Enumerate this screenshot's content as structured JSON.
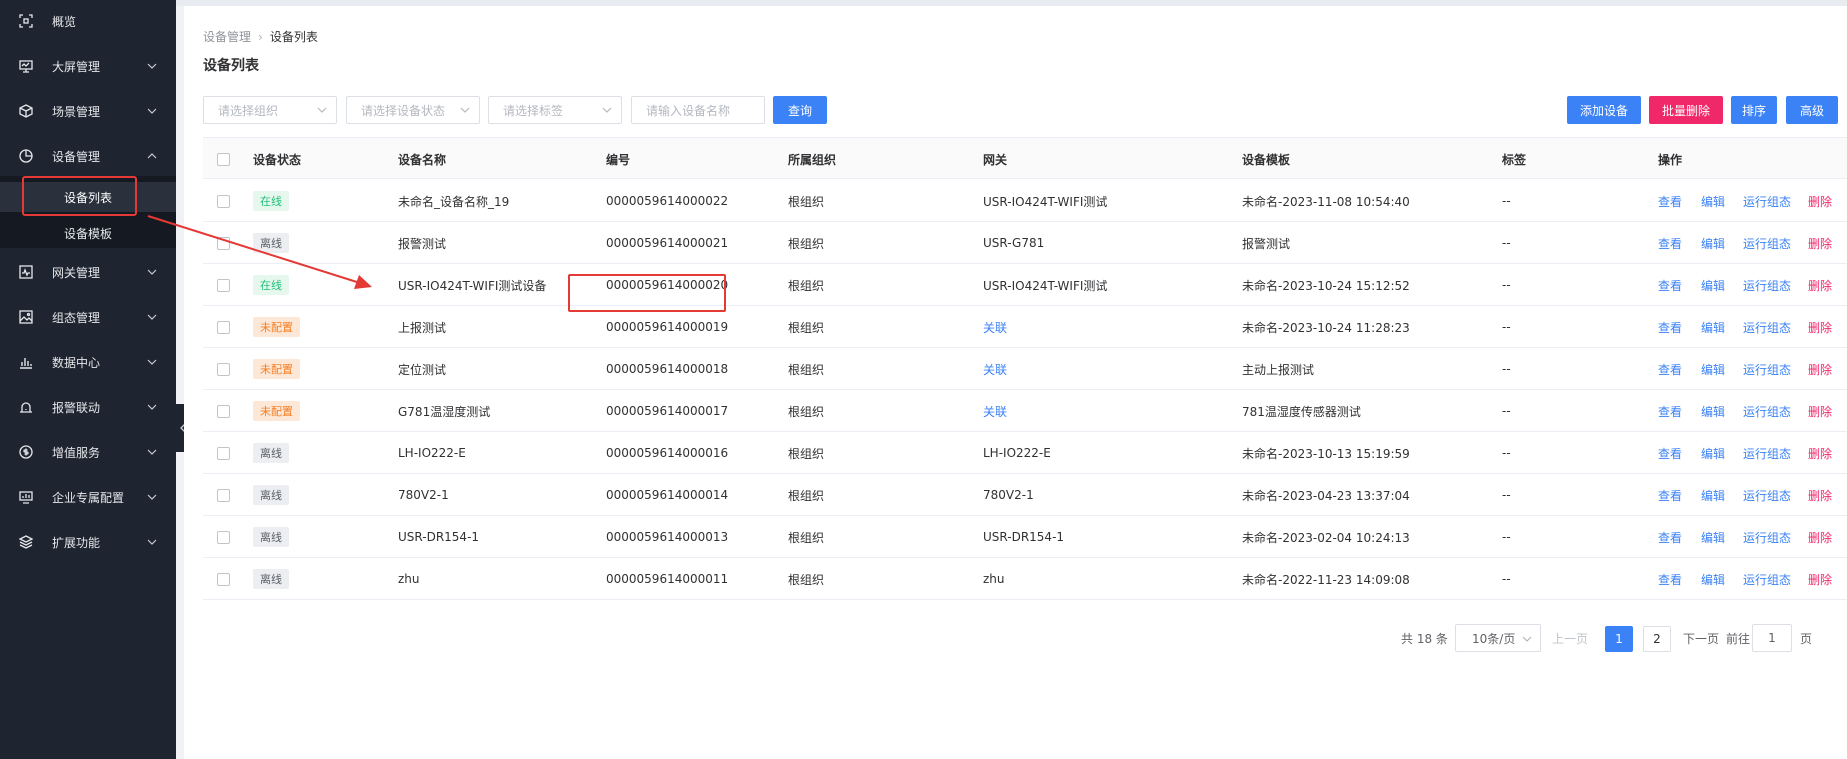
{
  "sidebar": {
    "items": [
      {
        "label": "概览",
        "icon": "scan-icon"
      },
      {
        "label": "大屏管理",
        "icon": "monitor-icon"
      },
      {
        "label": "场景管理",
        "icon": "cube-icon"
      },
      {
        "label": "设备管理",
        "icon": "pie-chart-icon"
      },
      {
        "label": "网关管理",
        "icon": "pulse-icon"
      },
      {
        "label": "组态管理",
        "icon": "image-icon"
      },
      {
        "label": "数据中心",
        "icon": "bar-chart-icon"
      },
      {
        "label": "报警联动",
        "icon": "alarm-icon"
      },
      {
        "label": "增值服务",
        "icon": "coin-icon"
      },
      {
        "label": "企业专属配置",
        "icon": "screen-icon"
      },
      {
        "label": "扩展功能",
        "icon": "layers-icon"
      }
    ],
    "subitems": [
      {
        "label": "设备列表"
      },
      {
        "label": "设备模板"
      }
    ]
  },
  "breadcrumb": {
    "parent": "设备管理",
    "current": "设备列表"
  },
  "page_title": "设备列表",
  "filters": {
    "org_placeholder": "请选择组织",
    "status_placeholder": "请选择设备状态",
    "tag_placeholder": "请选择标签",
    "name_placeholder": "请输入设备名称",
    "query_label": "查询"
  },
  "toolbar": {
    "add_label": "添加设备",
    "batch_delete_label": "批量删除",
    "sort_label": "排序",
    "advanced_label": "高级"
  },
  "table": {
    "headers": {
      "status": "设备状态",
      "name": "设备名称",
      "number": "编号",
      "org": "所属组织",
      "gateway": "网关",
      "template": "设备模板",
      "tag": "标签",
      "actions": "操作"
    },
    "rows": [
      {
        "status": "在线",
        "status_type": "online",
        "name": "未命名_设备名称_19",
        "number": "0000059614000022",
        "org": "根组织",
        "gateway": "USR-IO424T-WIFI测试",
        "gateway_link": false,
        "template": "未命名-2023-11-08 10:54:40",
        "tag": "--"
      },
      {
        "status": "离线",
        "status_type": "offline",
        "name": "报警测试",
        "number": "0000059614000021",
        "org": "根组织",
        "gateway": "USR-G781",
        "gateway_link": false,
        "template": "报警测试",
        "tag": "--"
      },
      {
        "status": "在线",
        "status_type": "online",
        "name": "USR-IO424T-WIFI测试设备",
        "number": "0000059614000020",
        "org": "根组织",
        "gateway": "USR-IO424T-WIFI测试",
        "gateway_link": false,
        "template": "未命名-2023-10-24 15:12:52",
        "tag": "--"
      },
      {
        "status": "未配置",
        "status_type": "unconfigured",
        "name": "上报测试",
        "number": "0000059614000019",
        "org": "根组织",
        "gateway": "关联",
        "gateway_link": true,
        "template": "未命名-2023-10-24 11:28:23",
        "tag": "--"
      },
      {
        "status": "未配置",
        "status_type": "unconfigured",
        "name": "定位测试",
        "number": "0000059614000018",
        "org": "根组织",
        "gateway": "关联",
        "gateway_link": true,
        "template": "主动上报测试",
        "tag": "--"
      },
      {
        "status": "未配置",
        "status_type": "unconfigured",
        "name": "G781温湿度测试",
        "number": "0000059614000017",
        "org": "根组织",
        "gateway": "关联",
        "gateway_link": true,
        "template": "781温湿度传感器测试",
        "tag": "--"
      },
      {
        "status": "离线",
        "status_type": "offline",
        "name": "LH-IO222-E",
        "number": "0000059614000016",
        "org": "根组织",
        "gateway": "LH-IO222-E",
        "gateway_link": false,
        "template": "未命名-2023-10-13 15:19:59",
        "tag": "--"
      },
      {
        "status": "离线",
        "status_type": "offline",
        "name": "780V2-1",
        "number": "0000059614000014",
        "org": "根组织",
        "gateway": "780V2-1",
        "gateway_link": false,
        "template": "未命名-2023-04-23 13:37:04",
        "tag": "--"
      },
      {
        "status": "离线",
        "status_type": "offline",
        "name": "USR-DR154-1",
        "number": "0000059614000013",
        "org": "根组织",
        "gateway": "USR-DR154-1",
        "gateway_link": false,
        "template": "未命名-2023-02-04 10:24:13",
        "tag": "--"
      },
      {
        "status": "离线",
        "status_type": "offline",
        "name": "zhu",
        "number": "0000059614000011",
        "org": "根组织",
        "gateway": "zhu",
        "gateway_link": false,
        "template": "未命名-2022-11-23 14:09:08",
        "tag": "--"
      }
    ],
    "actions": {
      "view": "查看",
      "edit": "编辑",
      "run": "运行组态",
      "delete": "删除"
    }
  },
  "pagination": {
    "total": "共 18 条",
    "page_size": "10条/页",
    "prev": "上一页",
    "pages": [
      "1",
      "2"
    ],
    "next": "下一页",
    "goto_label": "前往",
    "goto_value": "1",
    "page_unit": "页"
  }
}
